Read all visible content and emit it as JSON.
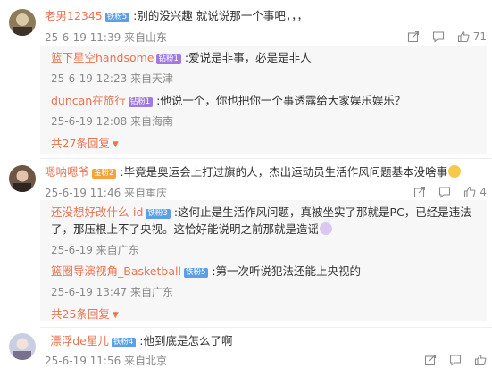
{
  "comments": [
    {
      "user": "老男12345",
      "badge": "铁粉5",
      "text": ":别的没兴趣 就说说那一个事吧，，，",
      "meta": "25-6-19 11:39 来自山东",
      "likes": "71",
      "replies": [
        {
          "user": "篮下星空handsome",
          "badge": "钻粉1",
          "text": ":爱说是非事，必是是非人",
          "meta": "25-6-19 12:23 来自天津"
        },
        {
          "user": "duncan在旅行",
          "badge": "钻粉1",
          "text": ":他说一个，你也把你一个事透露给大家娱乐娱乐？",
          "meta": "25-6-19 12:08 来自海南"
        }
      ],
      "more": "共27条回复"
    },
    {
      "user": "嗯呐嗯爷",
      "badge": "金粉2",
      "text": ":毕竟是奥运会上打过旗的人，杰出运动员生活作风问题基本没啥事",
      "meta": "25-6-19 11:46 来自重庆",
      "likes": "4",
      "replies": [
        {
          "user": "还没想好改什么-id",
          "badge": "铁粉3",
          "text": ":这何止是生活作风问题，真被坐实了那就是PC，已经是违法了，那压根上不了央视。这恰好能说明之前那就是造谣",
          "meta": "25-6-19 来自广东"
        },
        {
          "user": "篮圈导演视角_Basketball",
          "badge": "铁粉5",
          "text": ":第一次听说犯法还能上央视的",
          "meta": "25-6-19 13:47 来自广东"
        }
      ],
      "more": "共25条回复"
    },
    {
      "user": "_漂浮de星儿",
      "badge": "铁粉4",
      "text": ":他到底是怎么了啊",
      "meta": "25-6-19 11:56 来自北京",
      "likes": ""
    }
  ],
  "icons": {
    "share": "share-icon",
    "comment": "comment-icon",
    "like": "like-icon"
  }
}
